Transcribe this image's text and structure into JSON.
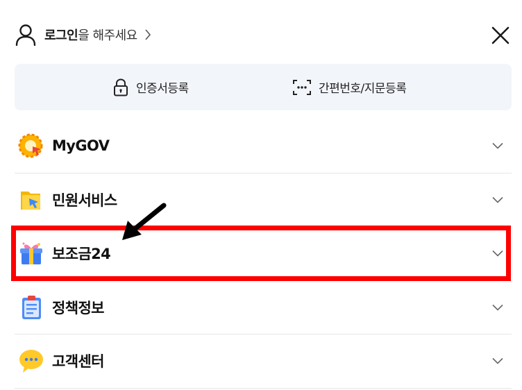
{
  "header": {
    "login_strong": "로그인",
    "login_rest": "을 해주세요"
  },
  "auth": {
    "cert_label": "인증서등록",
    "simple_label": "간편번호/지문등록"
  },
  "menu": {
    "items": [
      {
        "label": "MyGOV",
        "icon": "mygov-icon"
      },
      {
        "label": "민원서비스",
        "icon": "civil-service-icon"
      },
      {
        "label": "보조금24",
        "icon": "gift-icon"
      },
      {
        "label": "정책정보",
        "icon": "clipboard-icon"
      },
      {
        "label": "고객센터",
        "icon": "chat-bubble-icon"
      }
    ]
  },
  "annotation": {
    "highlight_color": "#ff0000",
    "arrow_color": "#000000"
  }
}
